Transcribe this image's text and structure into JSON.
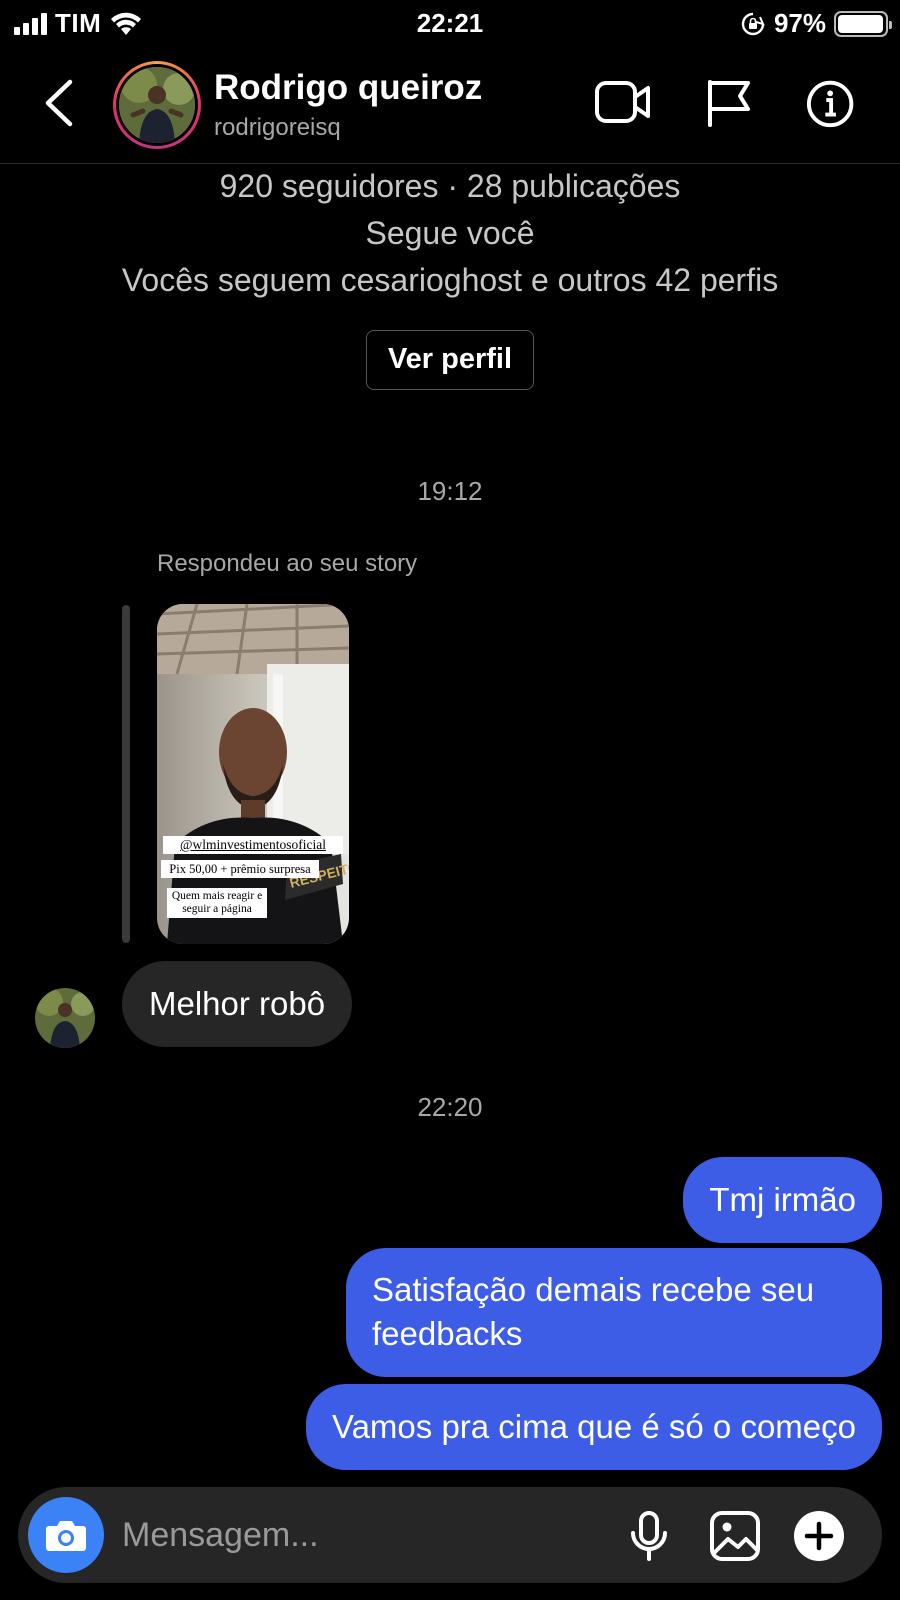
{
  "status_bar": {
    "carrier": "TIM",
    "time": "22:21",
    "battery": "97%",
    "battery_level": 0.97
  },
  "header": {
    "name": "Rodrigo queiroz",
    "username": "rodrigoreisq"
  },
  "profile": {
    "stats": "920 seguidores · 28 publicações",
    "follows_you": "Segue você",
    "mutuals": "Vocês seguem cesarioghost e outros 42 perfis",
    "view_profile": "Ver perfil"
  },
  "chat": {
    "timestamp1": "19:12",
    "reply_label": "Respondeu ao seu story",
    "story_stickers": {
      "handle": "@wlminvestimentosoficial",
      "pix": "Pix 50,00 + prêmio surpresa",
      "cta": "Quem mais reagir e seguir a página"
    },
    "incoming_message": "Melhor robô",
    "timestamp2": "22:20",
    "outgoing": [
      "Tmj irmão",
      "Satisfação demais recebe seu feedbacks",
      "Vamos pra cima que é só o começo"
    ]
  },
  "composer": {
    "placeholder": "Mensagem..."
  },
  "colors": {
    "background": "#000000",
    "outgoing_bubble": "#3e5de6",
    "incoming_bubble": "#262626",
    "camera_button": "#3b82f6"
  },
  "icons": [
    "back-arrow-icon",
    "video-call-icon",
    "flag-icon",
    "info-icon",
    "camera-icon",
    "microphone-icon",
    "gallery-icon",
    "plus-icon",
    "wifi-icon",
    "orientation-lock-icon"
  ]
}
